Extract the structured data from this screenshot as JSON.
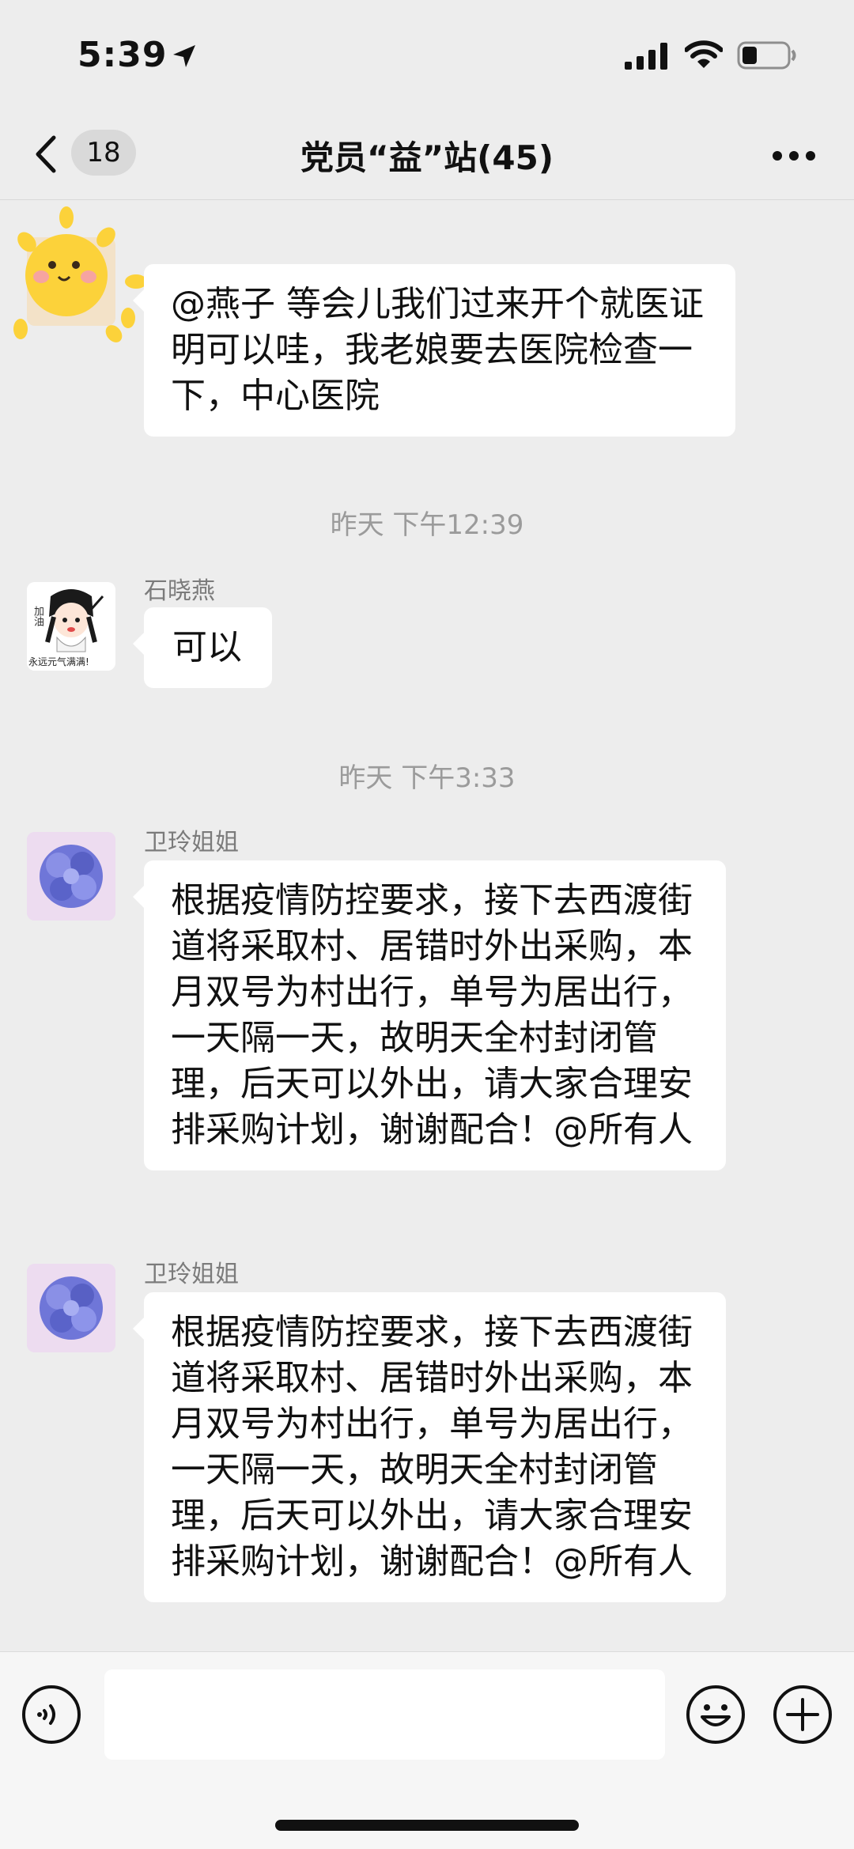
{
  "status_bar": {
    "time": "5:39"
  },
  "nav": {
    "unread_count": "18",
    "title": "党员“益”站(45)"
  },
  "messages": [
    {
      "type": "text",
      "text": "@燕子 等会儿我们过来开个就医证明可以哇，我老娘要去医院检查一下，中心医院"
    },
    {
      "type": "time",
      "text": "昨天 下午12:39"
    },
    {
      "type": "text",
      "sender": "石晓燕",
      "avatar_caption": "永远元气满满!",
      "avatar_tag": "加油",
      "text": "可以"
    },
    {
      "type": "time",
      "text": "昨天 下午3:33"
    },
    {
      "type": "text",
      "sender": "卫玲姐姐",
      "text": "根据疫情防控要求，接下去西渡街道将采取村、居错时外出采购，本月双号为村出行，单号为居出行，一天隔一天，故明天全村封闭管理，后天可以外出，请大家合理安排采购计划，谢谢配合！@所有人"
    },
    {
      "type": "text",
      "sender": "卫玲姐姐",
      "text": "根据疫情防控要求，接下去西渡街道将采取村、居错时外出采购，本月双号为村出行，单号为居出行，一天隔一天，故明天全村封闭管理，后天可以外出，请大家合理安排采购计划，谢谢配合！@所有人"
    }
  ],
  "input": {
    "value": "",
    "placeholder": ""
  },
  "icons": [
    "location-arrow-icon",
    "signal-icon",
    "wifi-icon",
    "battery-icon",
    "back-icon",
    "more-icon",
    "voice-icon",
    "emoji-icon",
    "plus-icon"
  ],
  "colors": {
    "background": "#ededed",
    "bubble": "#ffffff",
    "timestamp": "#9b9b9b",
    "sender": "#7b7b7b"
  }
}
